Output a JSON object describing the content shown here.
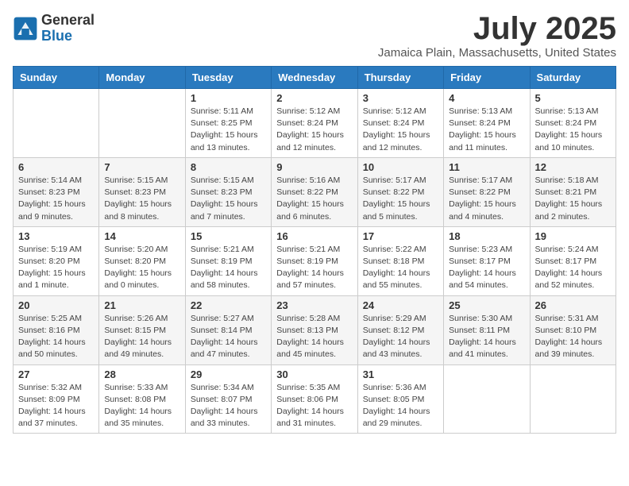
{
  "header": {
    "logo_general": "General",
    "logo_blue": "Blue",
    "month_title": "July 2025",
    "location": "Jamaica Plain, Massachusetts, United States"
  },
  "weekdays": [
    "Sunday",
    "Monday",
    "Tuesday",
    "Wednesday",
    "Thursday",
    "Friday",
    "Saturday"
  ],
  "weeks": [
    [
      {
        "day": "",
        "sunrise": "",
        "sunset": "",
        "daylight": ""
      },
      {
        "day": "",
        "sunrise": "",
        "sunset": "",
        "daylight": ""
      },
      {
        "day": "1",
        "sunrise": "Sunrise: 5:11 AM",
        "sunset": "Sunset: 8:25 PM",
        "daylight": "Daylight: 15 hours and 13 minutes."
      },
      {
        "day": "2",
        "sunrise": "Sunrise: 5:12 AM",
        "sunset": "Sunset: 8:24 PM",
        "daylight": "Daylight: 15 hours and 12 minutes."
      },
      {
        "day": "3",
        "sunrise": "Sunrise: 5:12 AM",
        "sunset": "Sunset: 8:24 PM",
        "daylight": "Daylight: 15 hours and 12 minutes."
      },
      {
        "day": "4",
        "sunrise": "Sunrise: 5:13 AM",
        "sunset": "Sunset: 8:24 PM",
        "daylight": "Daylight: 15 hours and 11 minutes."
      },
      {
        "day": "5",
        "sunrise": "Sunrise: 5:13 AM",
        "sunset": "Sunset: 8:24 PM",
        "daylight": "Daylight: 15 hours and 10 minutes."
      }
    ],
    [
      {
        "day": "6",
        "sunrise": "Sunrise: 5:14 AM",
        "sunset": "Sunset: 8:23 PM",
        "daylight": "Daylight: 15 hours and 9 minutes."
      },
      {
        "day": "7",
        "sunrise": "Sunrise: 5:15 AM",
        "sunset": "Sunset: 8:23 PM",
        "daylight": "Daylight: 15 hours and 8 minutes."
      },
      {
        "day": "8",
        "sunrise": "Sunrise: 5:15 AM",
        "sunset": "Sunset: 8:23 PM",
        "daylight": "Daylight: 15 hours and 7 minutes."
      },
      {
        "day": "9",
        "sunrise": "Sunrise: 5:16 AM",
        "sunset": "Sunset: 8:22 PM",
        "daylight": "Daylight: 15 hours and 6 minutes."
      },
      {
        "day": "10",
        "sunrise": "Sunrise: 5:17 AM",
        "sunset": "Sunset: 8:22 PM",
        "daylight": "Daylight: 15 hours and 5 minutes."
      },
      {
        "day": "11",
        "sunrise": "Sunrise: 5:17 AM",
        "sunset": "Sunset: 8:22 PM",
        "daylight": "Daylight: 15 hours and 4 minutes."
      },
      {
        "day": "12",
        "sunrise": "Sunrise: 5:18 AM",
        "sunset": "Sunset: 8:21 PM",
        "daylight": "Daylight: 15 hours and 2 minutes."
      }
    ],
    [
      {
        "day": "13",
        "sunrise": "Sunrise: 5:19 AM",
        "sunset": "Sunset: 8:20 PM",
        "daylight": "Daylight: 15 hours and 1 minute."
      },
      {
        "day": "14",
        "sunrise": "Sunrise: 5:20 AM",
        "sunset": "Sunset: 8:20 PM",
        "daylight": "Daylight: 15 hours and 0 minutes."
      },
      {
        "day": "15",
        "sunrise": "Sunrise: 5:21 AM",
        "sunset": "Sunset: 8:19 PM",
        "daylight": "Daylight: 14 hours and 58 minutes."
      },
      {
        "day": "16",
        "sunrise": "Sunrise: 5:21 AM",
        "sunset": "Sunset: 8:19 PM",
        "daylight": "Daylight: 14 hours and 57 minutes."
      },
      {
        "day": "17",
        "sunrise": "Sunrise: 5:22 AM",
        "sunset": "Sunset: 8:18 PM",
        "daylight": "Daylight: 14 hours and 55 minutes."
      },
      {
        "day": "18",
        "sunrise": "Sunrise: 5:23 AM",
        "sunset": "Sunset: 8:17 PM",
        "daylight": "Daylight: 14 hours and 54 minutes."
      },
      {
        "day": "19",
        "sunrise": "Sunrise: 5:24 AM",
        "sunset": "Sunset: 8:17 PM",
        "daylight": "Daylight: 14 hours and 52 minutes."
      }
    ],
    [
      {
        "day": "20",
        "sunrise": "Sunrise: 5:25 AM",
        "sunset": "Sunset: 8:16 PM",
        "daylight": "Daylight: 14 hours and 50 minutes."
      },
      {
        "day": "21",
        "sunrise": "Sunrise: 5:26 AM",
        "sunset": "Sunset: 8:15 PM",
        "daylight": "Daylight: 14 hours and 49 minutes."
      },
      {
        "day": "22",
        "sunrise": "Sunrise: 5:27 AM",
        "sunset": "Sunset: 8:14 PM",
        "daylight": "Daylight: 14 hours and 47 minutes."
      },
      {
        "day": "23",
        "sunrise": "Sunrise: 5:28 AM",
        "sunset": "Sunset: 8:13 PM",
        "daylight": "Daylight: 14 hours and 45 minutes."
      },
      {
        "day": "24",
        "sunrise": "Sunrise: 5:29 AM",
        "sunset": "Sunset: 8:12 PM",
        "daylight": "Daylight: 14 hours and 43 minutes."
      },
      {
        "day": "25",
        "sunrise": "Sunrise: 5:30 AM",
        "sunset": "Sunset: 8:11 PM",
        "daylight": "Daylight: 14 hours and 41 minutes."
      },
      {
        "day": "26",
        "sunrise": "Sunrise: 5:31 AM",
        "sunset": "Sunset: 8:10 PM",
        "daylight": "Daylight: 14 hours and 39 minutes."
      }
    ],
    [
      {
        "day": "27",
        "sunrise": "Sunrise: 5:32 AM",
        "sunset": "Sunset: 8:09 PM",
        "daylight": "Daylight: 14 hours and 37 minutes."
      },
      {
        "day": "28",
        "sunrise": "Sunrise: 5:33 AM",
        "sunset": "Sunset: 8:08 PM",
        "daylight": "Daylight: 14 hours and 35 minutes."
      },
      {
        "day": "29",
        "sunrise": "Sunrise: 5:34 AM",
        "sunset": "Sunset: 8:07 PM",
        "daylight": "Daylight: 14 hours and 33 minutes."
      },
      {
        "day": "30",
        "sunrise": "Sunrise: 5:35 AM",
        "sunset": "Sunset: 8:06 PM",
        "daylight": "Daylight: 14 hours and 31 minutes."
      },
      {
        "day": "31",
        "sunrise": "Sunrise: 5:36 AM",
        "sunset": "Sunset: 8:05 PM",
        "daylight": "Daylight: 14 hours and 29 minutes."
      },
      {
        "day": "",
        "sunrise": "",
        "sunset": "",
        "daylight": ""
      },
      {
        "day": "",
        "sunrise": "",
        "sunset": "",
        "daylight": ""
      }
    ]
  ]
}
